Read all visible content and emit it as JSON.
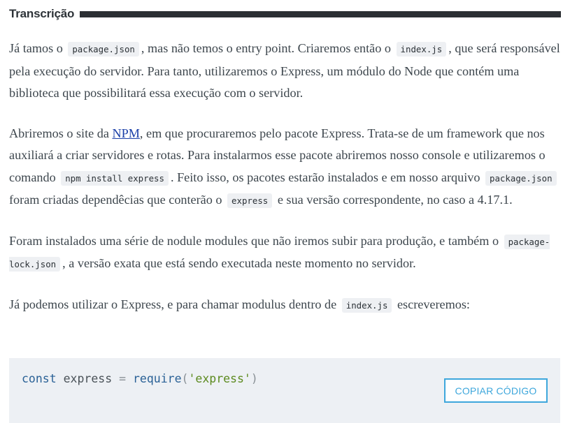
{
  "header": {
    "title": "Transcrição"
  },
  "paragraphs": {
    "p1": {
      "t1": "Já tamos o",
      "c1": "package.json",
      "t2": ", mas não temos o entry point. Criaremos então o",
      "c2": "index.js",
      "t3": ", que será responsável pela execução do servidor. Para tanto, utilizaremos o Express, um módulo do Node que contém uma biblioteca que possibilitará essa execução com o servidor."
    },
    "p2": {
      "t1": "Abriremos o site da ",
      "link": "NPM",
      "t2": ", em que procuraremos pelo pacote Express. Trata-se de um framework que nos auxiliará a criar servidores e rotas. Para instalarmos esse pacote abriremos nosso console e utilizaremos o comando",
      "c1": "npm install express",
      "t3": ". Feito isso, os pacotes estarão instalados e em nosso arquivo",
      "c2": "package.json",
      "t4": "foram criadas dependêcias que conterão o",
      "c3": "express",
      "t5": "e sua versão correspondente, no caso a 4.17.1."
    },
    "p3": {
      "t1": "Foram instalados uma série de nodule modules que não iremos subir para produção, e também o",
      "c1": "package-lock.json",
      "t2": ", a versão exata que está sendo executada neste momento no servidor."
    },
    "p4": {
      "t1": "Já podemos utilizar o Express, e para chamar modulus dentro de",
      "c1": "index.js",
      "t2": "escreveremos:"
    }
  },
  "code_block": {
    "keyword": "const",
    "identifier": "express",
    "operator": "=",
    "function": "require",
    "open_paren": "(",
    "string": "'express'",
    "close_paren": ")",
    "copy_label": "COPIAR CÓDIGO"
  },
  "colors": {
    "link": "#1a3fa8",
    "copy_button": "#3ea7dc",
    "code_background": "#edf0f4",
    "header_bar": "#2b2f33"
  }
}
